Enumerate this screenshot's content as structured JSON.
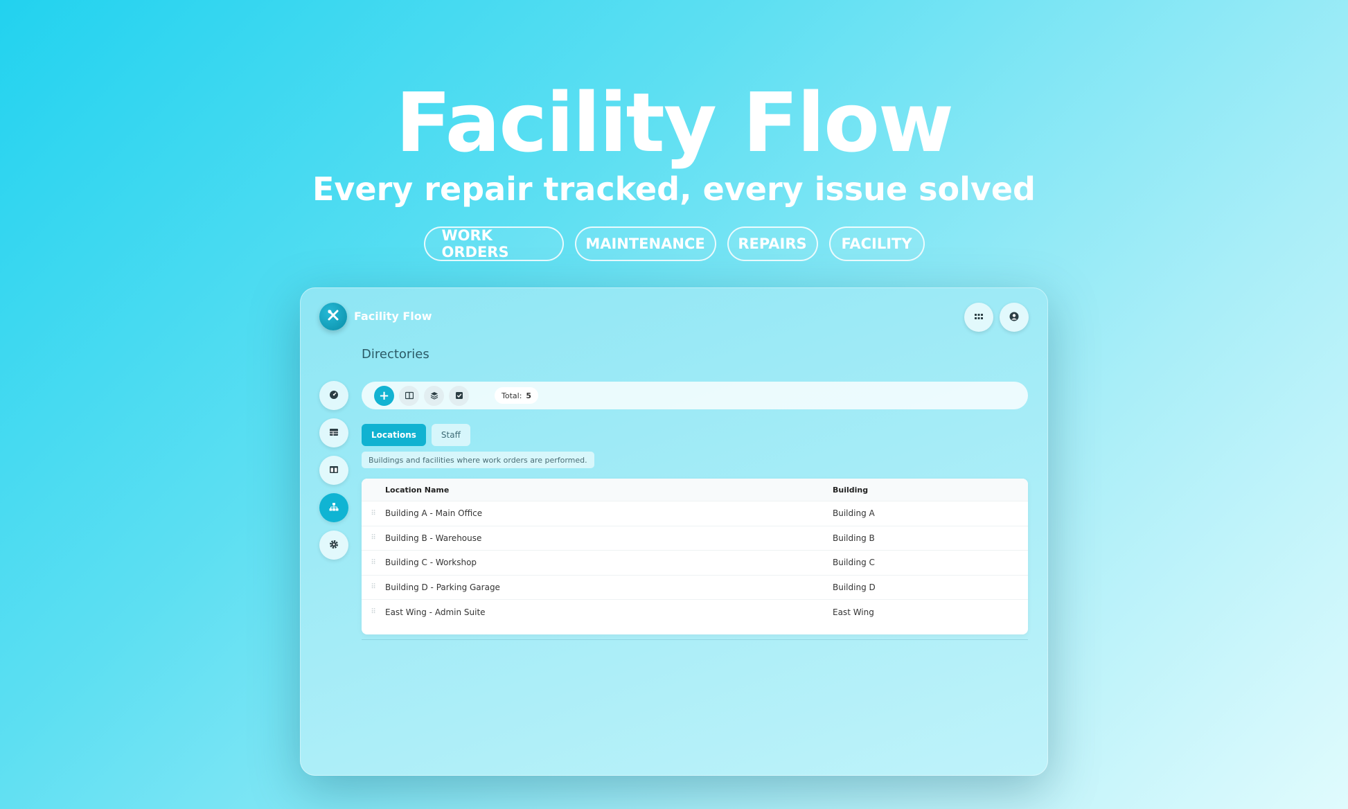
{
  "hero": {
    "title": "Facility Flow",
    "subtitle": "Every repair tracked, every issue solved",
    "tags": [
      "WORK ORDERS",
      "MAINTENANCE",
      "REPAIRS",
      "FACILITY"
    ]
  },
  "app": {
    "name": "Facility Flow",
    "page_title": "Directories",
    "toolbar": {
      "add_label": "+",
      "total_label": "Total:",
      "total_value": "5"
    },
    "tabs": [
      {
        "label": "Locations",
        "active": true
      },
      {
        "label": "Staff",
        "active": false
      }
    ],
    "description": "Buildings and facilities where work orders are performed.",
    "table": {
      "columns": [
        "Location Name",
        "Building"
      ],
      "rows": [
        [
          "Building A - Main Office",
          "Building A"
        ],
        [
          "Building B - Warehouse",
          "Building B"
        ],
        [
          "Building C - Workshop",
          "Building C"
        ],
        [
          "Building D - Parking Garage",
          "Building D"
        ],
        [
          "East Wing - Admin Suite",
          "East Wing"
        ]
      ]
    },
    "sidebar_icons": [
      "dashboard-icon",
      "table-icon",
      "columns-icon",
      "sitemap-icon",
      "gear-icon"
    ],
    "colors": {
      "accent": "#10b4d3",
      "bg_start": "#22d2ef",
      "bg_end": "#e0fbfd"
    }
  }
}
